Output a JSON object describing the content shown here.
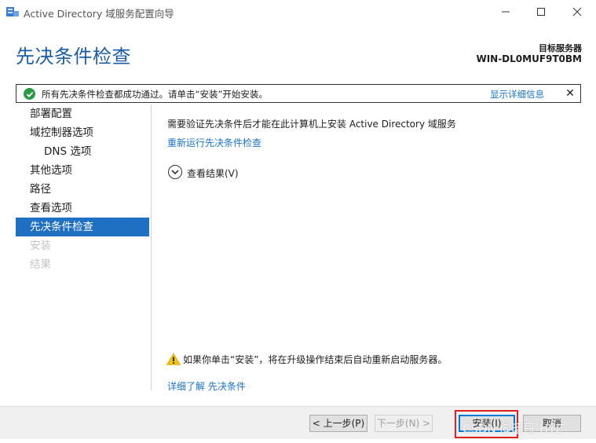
{
  "window": {
    "title": "Active Directory 域服务配置向导",
    "minimize_icon": "minimize-icon",
    "maximize_icon": "maximize-icon",
    "close_icon": "close-icon"
  },
  "header": {
    "page_title": "先决条件检查",
    "target_server_label": "目标服务器",
    "target_server_name": "WIN-DL0MUF9T0BM"
  },
  "status_banner": {
    "message": "所有先决条件检查都成功通过。请单击“安装”开始安装。",
    "details_link": "显示详细信息",
    "icon": "check-circle-icon",
    "close_icon": "close-icon"
  },
  "nav": {
    "items": [
      {
        "label": "部署配置",
        "state": "normal"
      },
      {
        "label": "域控制器选项",
        "state": "normal"
      },
      {
        "label": "DNS 选项",
        "state": "sub"
      },
      {
        "label": "其他选项",
        "state": "normal"
      },
      {
        "label": "路径",
        "state": "normal"
      },
      {
        "label": "查看选项",
        "state": "normal"
      },
      {
        "label": "先决条件检查",
        "state": "active"
      },
      {
        "label": "安装",
        "state": "disabled"
      },
      {
        "label": "结果",
        "state": "disabled"
      }
    ]
  },
  "main": {
    "description": "需要验证先决条件后才能在此计算机上安装 Active Directory 域服务",
    "rerun_link": "重新运行先决条件检查",
    "view_results_label": "查看结果(V)",
    "warning_text": "如果你单击“安装”，将在升级操作结束后自动重新启动服务器。",
    "more_link": "详细了解 先决条件"
  },
  "footer": {
    "prev_label": "< 上一步(P)",
    "next_label": "下一步(N) >",
    "install_label": "安装(I)",
    "cancel_label": "取消"
  },
  "watermark": "CSDN @昭哥-HYZ",
  "colors": {
    "accent": "#1f6fc3",
    "title_blue": "#1a5da8",
    "link_blue": "#1a73c9",
    "success_green": "#2b9a42",
    "highlight_red": "#e0211b"
  }
}
